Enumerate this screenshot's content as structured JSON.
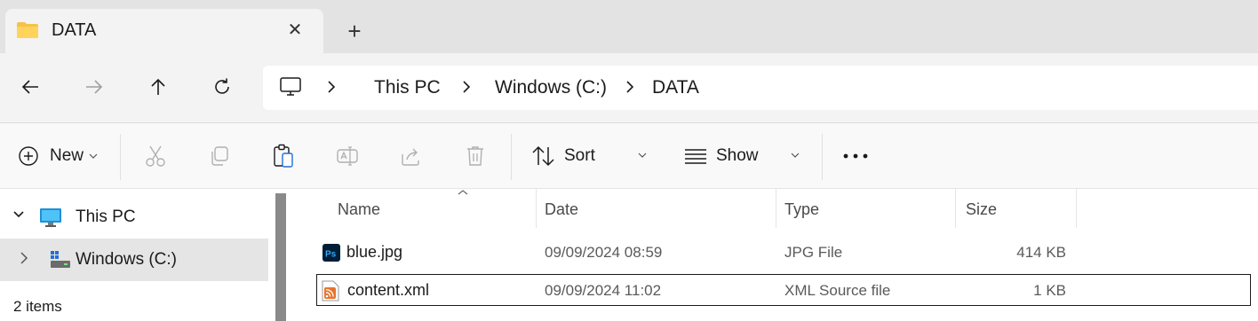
{
  "tab": {
    "title": "DATA",
    "close_glyph": "✕",
    "new_tab_glyph": "+"
  },
  "nav": {
    "back_icon": "arrow-left-icon",
    "forward_icon": "arrow-right-icon",
    "up_icon": "arrow-up-icon",
    "refresh_icon": "refresh-icon"
  },
  "breadcrumb": {
    "root_icon": "monitor-icon",
    "items": [
      "This PC",
      "Windows (C:)",
      "DATA"
    ]
  },
  "commands": {
    "new_label": "New",
    "sort_label": "Sort",
    "show_label": "Show",
    "more_glyph": "•••"
  },
  "tree": {
    "items": [
      {
        "label": "This PC",
        "expanded": true,
        "selected": false,
        "icon": "monitor-icon"
      },
      {
        "label": "Windows (C:)",
        "expanded": false,
        "selected": true,
        "icon": "drive-icon"
      }
    ]
  },
  "status": {
    "item_count": "2 items"
  },
  "columns": [
    "Name",
    "Date",
    "Type",
    "Size"
  ],
  "files": [
    {
      "name": "blue.jpg",
      "date": "09/09/2024 08:59",
      "type": "JPG File",
      "size": "414 KB",
      "icon": "photoshop-file-icon"
    },
    {
      "name": "content.xml",
      "date": "09/09/2024 11:02",
      "type": "XML Source file",
      "size": "1 KB",
      "icon": "xml-rss-file-icon"
    }
  ],
  "colors": {
    "accent_ps": "#001e36",
    "ps_text": "#31a8ff",
    "xml_orange": "#e8742c",
    "folder_yellow": "#f5c24a"
  }
}
